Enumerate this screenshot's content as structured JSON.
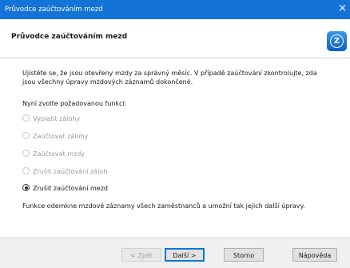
{
  "window": {
    "title": "Průvodce zaúčtováním mezd",
    "close_glyph": "×"
  },
  "header": {
    "title": "Průvodce zaúčtováním mezd",
    "logo_icon": "money-s3-logo-icon",
    "logo_glyph": "Z"
  },
  "content": {
    "intro": "Ujistěte se, že jsou otevřeny mzdy za správný měsíc. V případě zaúčtování zkontrolujte, zda jsou všechny úpravy mzdových záznamů dokončené.",
    "prompt": "Nyní zvolte požadovanou funkci:",
    "options": [
      {
        "label": "Vyplatit zálohy",
        "enabled": false,
        "checked": false
      },
      {
        "label": "Zaúčtovat zálohy",
        "enabled": false,
        "checked": false
      },
      {
        "label": "Zaúčtovat mzdy",
        "enabled": false,
        "checked": false
      },
      {
        "label": "Zrušit zaúčtování záloh",
        "enabled": false,
        "checked": false
      },
      {
        "label": "Zrušit zaúčtování mezd",
        "enabled": true,
        "checked": true
      }
    ],
    "note": "Funkce odemkne mzdové záznamy všech zaměstnanců a umožní tak jejich další úpravy."
  },
  "footer": {
    "back_label": "< Zpět",
    "next_label": "Další >",
    "cancel_label": "Storno",
    "help_label": "Nápověda"
  },
  "colors": {
    "titlebar": "#1473d6",
    "accent": "#0078d7"
  }
}
